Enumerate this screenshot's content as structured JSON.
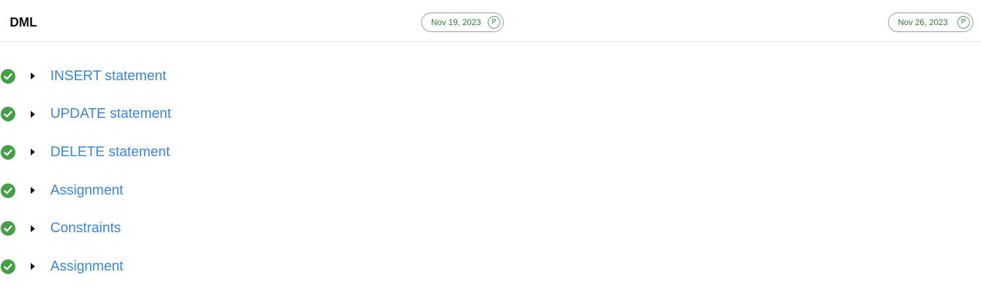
{
  "section": {
    "title": "DML"
  },
  "dates": [
    {
      "label": "Nov 19, 2023",
      "status": "P"
    },
    {
      "label": "Nov 26, 2023",
      "status": "P"
    }
  ],
  "items": [
    {
      "label": "INSERT statement",
      "status_icon": "check-circle-icon",
      "expand_icon": "caret-right-icon"
    },
    {
      "label": "UPDATE statement",
      "status_icon": "check-circle-icon",
      "expand_icon": "caret-right-icon"
    },
    {
      "label": "DELETE statement",
      "status_icon": "check-circle-icon",
      "expand_icon": "caret-right-icon"
    },
    {
      "label": "Assignment",
      "status_icon": "check-circle-icon",
      "expand_icon": "caret-right-icon"
    },
    {
      "label": "Constraints",
      "status_icon": "check-circle-icon",
      "expand_icon": "caret-right-icon"
    },
    {
      "label": "Assignment",
      "status_icon": "check-circle-icon",
      "expand_icon": "caret-right-icon"
    }
  ],
  "colors": {
    "check_green": "#43a047",
    "link_blue": "#3a86d8",
    "date_green": "#2e7d32"
  }
}
